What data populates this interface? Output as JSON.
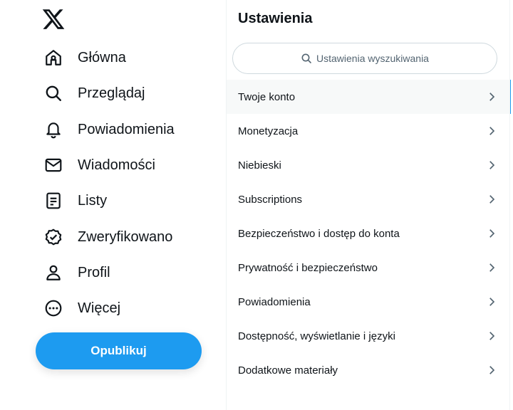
{
  "nav": {
    "logo_icon": "x-logo-icon",
    "items": [
      {
        "label": "Główna",
        "icon": "home-icon"
      },
      {
        "label": "Przeglądaj",
        "icon": "search-icon"
      },
      {
        "label": "Powiadomienia",
        "icon": "bell-icon"
      },
      {
        "label": "Wiadomości",
        "icon": "mail-icon"
      },
      {
        "label": "Listy",
        "icon": "list-icon"
      },
      {
        "label": "Zweryfikowano",
        "icon": "verified-icon"
      },
      {
        "label": "Profil",
        "icon": "user-icon"
      },
      {
        "label": "Więcej",
        "icon": "more-circle-icon"
      }
    ],
    "publish_label": "Opublikuj"
  },
  "settings": {
    "title": "Ustawienia",
    "search_placeholder": "Ustawienia wyszukiwania",
    "items": [
      {
        "label": "Twoje konto",
        "active": true
      },
      {
        "label": "Monetyzacja"
      },
      {
        "label": "Niebieski"
      },
      {
        "label": "Subscriptions"
      },
      {
        "label": "Bezpieczeństwo i dostęp do konta"
      },
      {
        "label": "Prywatność i bezpieczeństwo"
      },
      {
        "label": "Powiadomienia"
      },
      {
        "label": "Dostępność, wyświetlanie i języki"
      },
      {
        "label": "Dodatkowe materiały"
      }
    ]
  },
  "colors": {
    "accent": "#1d9bf0",
    "text": "#0f1419",
    "muted": "#536471",
    "active_row_bg": "#f7f9f9"
  }
}
